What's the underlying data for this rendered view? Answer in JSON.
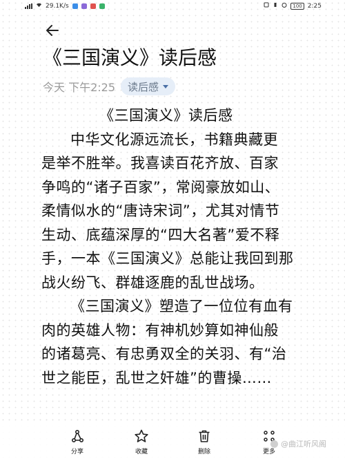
{
  "status_bar": {
    "net_speed": "29.1K/s",
    "time": "2:25",
    "battery": "100"
  },
  "header": {
    "title": "《三国演义》读后感",
    "timestamp": "今天 下午2:25",
    "category_tag": "读后感"
  },
  "content": {
    "lines": [
      "《三国演义》读后感",
      "中华文化源远流长，书籍典藏更",
      "是举不胜举。我喜读百花齐放、百家",
      "争鸣的“诸子百家”，常阅豪放如山、",
      "柔情似水的“唐诗宋词”，尤其对情节",
      "生动、底蕴深厚的“四大名著”爱不释",
      "手，一本《三国演义》总能让我回到那",
      "战火纷飞、群雄逐鹿的乱世战场。",
      "《三国演义》塑造了一位位有血有",
      "肉的英雄人物：有神机妙算如神仙般",
      "的诸葛亮、有忠勇双全的关羽、有“治",
      "世之能臣，乱世之奸雄”的曹操……"
    ]
  },
  "toolbar": {
    "share_label": "分享",
    "favorite_label": "收藏",
    "delete_label": "删除",
    "more_label": "更多"
  },
  "watermark": {
    "text": "@曲江听风阁"
  },
  "colors": {
    "accent": "#4a6fa5",
    "chip_bg": "#e6eef8",
    "muted_text": "#9a9a9a"
  }
}
